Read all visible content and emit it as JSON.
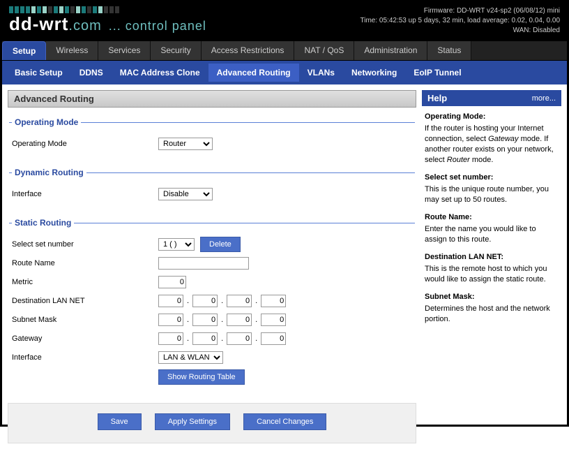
{
  "header": {
    "logo_text": "dd-wrt",
    "logo_com": ".com",
    "logo_sub": "... control panel",
    "firmware": "Firmware: DD-WRT v24-sp2 (06/08/12) mini",
    "time": "Time: 05:42:53 up 5 days, 32 min, load average: 0.02, 0.04, 0.00",
    "wan": "WAN: Disabled"
  },
  "mainnav": [
    "Setup",
    "Wireless",
    "Services",
    "Security",
    "Access Restrictions",
    "NAT / QoS",
    "Administration",
    "Status"
  ],
  "mainnav_active": 0,
  "subnav": [
    "Basic Setup",
    "DDNS",
    "MAC Address Clone",
    "Advanced Routing",
    "VLANs",
    "Networking",
    "EoIP Tunnel"
  ],
  "subnav_active": 3,
  "page_title": "Advanced Routing",
  "sections": {
    "opmode": {
      "legend": "Operating Mode",
      "label": "Operating Mode",
      "value": "Router"
    },
    "dynroute": {
      "legend": "Dynamic Routing",
      "label": "Interface",
      "value": "Disable"
    },
    "static": {
      "legend": "Static Routing",
      "setnum_label": "Select set number",
      "setnum_value": "1 ( )",
      "delete": "Delete",
      "routename_label": "Route Name",
      "routename_value": "",
      "metric_label": "Metric",
      "metric_value": "0",
      "dest_label": "Destination LAN NET",
      "dest": [
        "0",
        "0",
        "0",
        "0"
      ],
      "mask_label": "Subnet Mask",
      "mask": [
        "0",
        "0",
        "0",
        "0"
      ],
      "gw_label": "Gateway",
      "gw": [
        "0",
        "0",
        "0",
        "0"
      ],
      "iface_label": "Interface",
      "iface_value": "LAN & WLAN",
      "show_rt": "Show Routing Table"
    }
  },
  "actions": {
    "save": "Save",
    "apply": "Apply Settings",
    "cancel": "Cancel Changes"
  },
  "help": {
    "title": "Help",
    "more": "more...",
    "items": [
      {
        "t": "Operating Mode:",
        "d": "If the router is hosting your Internet connection, select <em>Gateway</em> mode. If another router exists on your network, select <em>Router</em> mode."
      },
      {
        "t": "Select set number:",
        "d": "This is the unique route number, you may set up to 50 routes."
      },
      {
        "t": "Route Name:",
        "d": "Enter the name you would like to assign to this route."
      },
      {
        "t": "Destination LAN NET:",
        "d": "This is the remote host to which you would like to assign the static route."
      },
      {
        "t": "Subnet Mask:",
        "d": "Determines the host and the network portion."
      }
    ]
  }
}
